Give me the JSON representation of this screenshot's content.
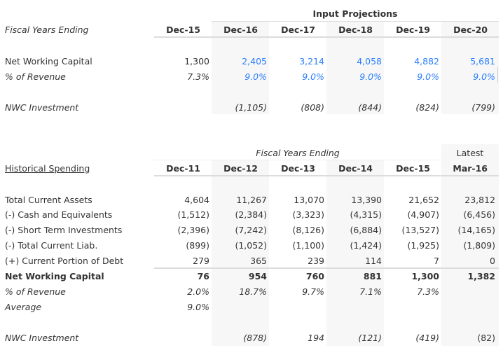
{
  "projections": {
    "group_header": "Input Projections",
    "row_header_label": "Fiscal Years Ending",
    "columns": [
      "Dec-15",
      "Dec-16",
      "Dec-17",
      "Dec-18",
      "Dec-19",
      "Dec-20"
    ],
    "rows": {
      "nwc": {
        "label": "Net Working Capital",
        "values": [
          "1,300",
          "2,405",
          "3,214",
          "4,058",
          "4,882",
          "5,681"
        ]
      },
      "pct_revenue": {
        "label": "% of Revenue",
        "values": [
          "7.3%",
          "9.0%",
          "9.0%",
          "9.0%",
          "9.0%",
          "9.0%"
        ]
      },
      "nwc_investment": {
        "label": "NWC Investment",
        "values": [
          "",
          "(1,105)",
          "(808)",
          "(844)",
          "(824)",
          "(799)"
        ]
      }
    }
  },
  "historical": {
    "title": "Historical Spending",
    "group_header": "Fiscal Years Ending",
    "latest_header": "Latest",
    "columns": [
      "Dec-11",
      "Dec-12",
      "Dec-13",
      "Dec-14",
      "Dec-15",
      "Mar-16"
    ],
    "rows": [
      {
        "label": "Total Current Assets",
        "values": [
          "4,604",
          "11,267",
          "13,070",
          "13,390",
          "21,652",
          "23,812"
        ]
      },
      {
        "label": "(-) Cash and Equivalents",
        "values": [
          "(1,512)",
          "(2,384)",
          "(3,323)",
          "(4,315)",
          "(4,907)",
          "(6,456)"
        ]
      },
      {
        "label": "(-) Short Term Investments",
        "values": [
          "(2,396)",
          "(7,242)",
          "(8,126)",
          "(6,884)",
          "(13,527)",
          "(14,165)"
        ]
      },
      {
        "label": "(-) Total Current Liab.",
        "values": [
          "(899)",
          "(1,052)",
          "(1,100)",
          "(1,424)",
          "(1,925)",
          "(1,809)"
        ]
      },
      {
        "label": "(+) Current Portion of Debt",
        "values": [
          "279",
          "365",
          "239",
          "114",
          "7",
          "0"
        ]
      }
    ],
    "nwc": {
      "label": "Net Working Capital",
      "values": [
        "76",
        "954",
        "760",
        "881",
        "1,300",
        "1,382"
      ]
    },
    "pct_revenue": {
      "label": "% of Revenue",
      "values": [
        "2.0%",
        "18.7%",
        "9.7%",
        "7.1%",
        "7.3%",
        ""
      ]
    },
    "average": {
      "label": "Average",
      "values": [
        "9.0%",
        "",
        "",
        "",
        "",
        ""
      ]
    },
    "nwc_investment": {
      "label": "NWC Investment",
      "values": [
        "",
        "(878)",
        "194",
        "(121)",
        "(419)",
        "(82)"
      ]
    }
  },
  "colors": {
    "input_blue": "#2a7fff",
    "text": "#333333",
    "shade": "#f7f7f7"
  }
}
